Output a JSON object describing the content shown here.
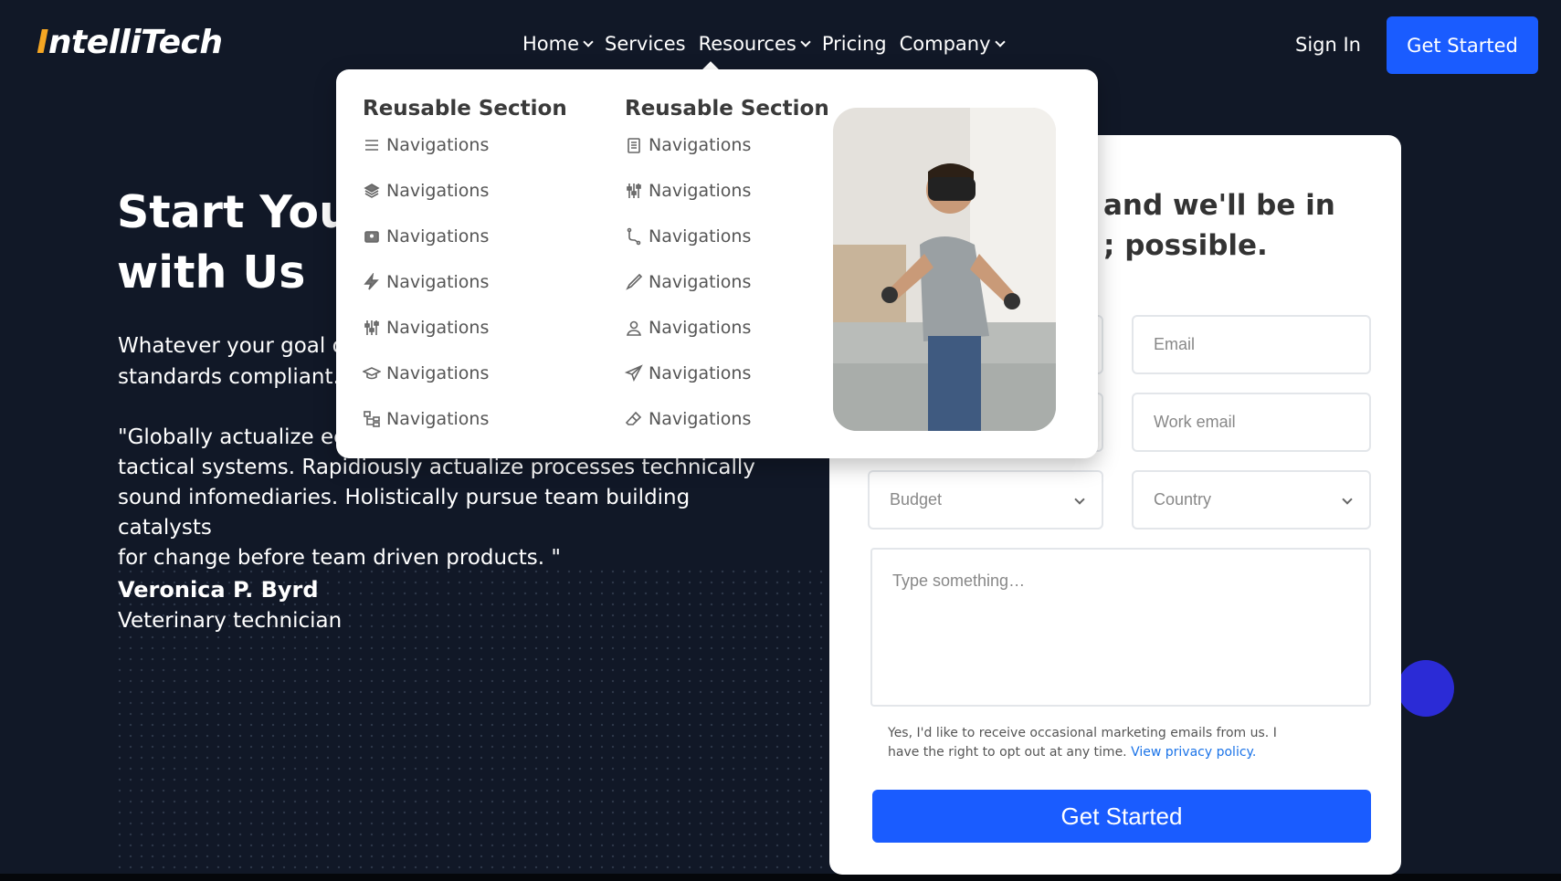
{
  "brand": {
    "logo_first": "I",
    "logo_rest": "ntelliTech",
    "accent_color": "#f5a623"
  },
  "nav": {
    "items": [
      {
        "label": "Home",
        "has_dropdown": true
      },
      {
        "label": "Services",
        "has_dropdown": false
      },
      {
        "label": "Resources",
        "has_dropdown": true
      },
      {
        "label": "Pricing",
        "has_dropdown": false
      },
      {
        "label": "Company",
        "has_dropdown": true
      }
    ],
    "sign_in": "Sign In",
    "cta": "Get Started"
  },
  "hero": {
    "title_line1": "Start Your",
    "title_line2": "with Us",
    "text_line1": "Whatever your goal o",
    "text_line2": "standards compliant. ",
    "quote_line1": "\"Globally actualize eco",
    "quote_line2": "tactical systems. Rapidiously actualize processes technically",
    "quote_line3": "sound infomediaries. Holistically pursue team building catalysts",
    "quote_line4": "for change before team driven products. \"",
    "author_name": "Veronica P. Byrd",
    "author_role": "Veterinary technician"
  },
  "form": {
    "heading_line1": "and we'll be in",
    "heading_line2": "; possible.",
    "email_placeholder": "Email",
    "work_email_placeholder": "Work email",
    "budget_label": "Budget",
    "country_label": "Country",
    "message_placeholder": "Type something…",
    "consent_text": "Yes, I'd like to receive occasional marketing emails from us. I have the right to opt out at any time. ",
    "privacy_link": "View privacy policy.",
    "submit": "Get Started",
    "primary_color": "#1a5cff"
  },
  "mega_menu": {
    "columns": [
      {
        "title": "Reusable Section",
        "items": [
          {
            "icon": "list-icon",
            "label": "Navigations"
          },
          {
            "icon": "layers-icon",
            "label": "Navigations"
          },
          {
            "icon": "id-card-icon",
            "label": "Navigations"
          },
          {
            "icon": "lightning-icon",
            "label": "Navigations"
          },
          {
            "icon": "sliders-icon",
            "label": "Navigations"
          },
          {
            "icon": "graduation-cap-icon",
            "label": "Navigations"
          },
          {
            "icon": "sitemap-icon",
            "label": "Navigations"
          }
        ]
      },
      {
        "title": "Reusable Section",
        "items": [
          {
            "icon": "clipboard-icon",
            "label": "Navigations"
          },
          {
            "icon": "sliders-icon",
            "label": "Navigations"
          },
          {
            "icon": "branch-icon",
            "label": "Navigations"
          },
          {
            "icon": "pen-icon",
            "label": "Navigations"
          },
          {
            "icon": "user-icon",
            "label": "Navigations"
          },
          {
            "icon": "send-icon",
            "label": "Navigations"
          },
          {
            "icon": "eraser-icon",
            "label": "Navigations"
          }
        ]
      }
    ]
  }
}
